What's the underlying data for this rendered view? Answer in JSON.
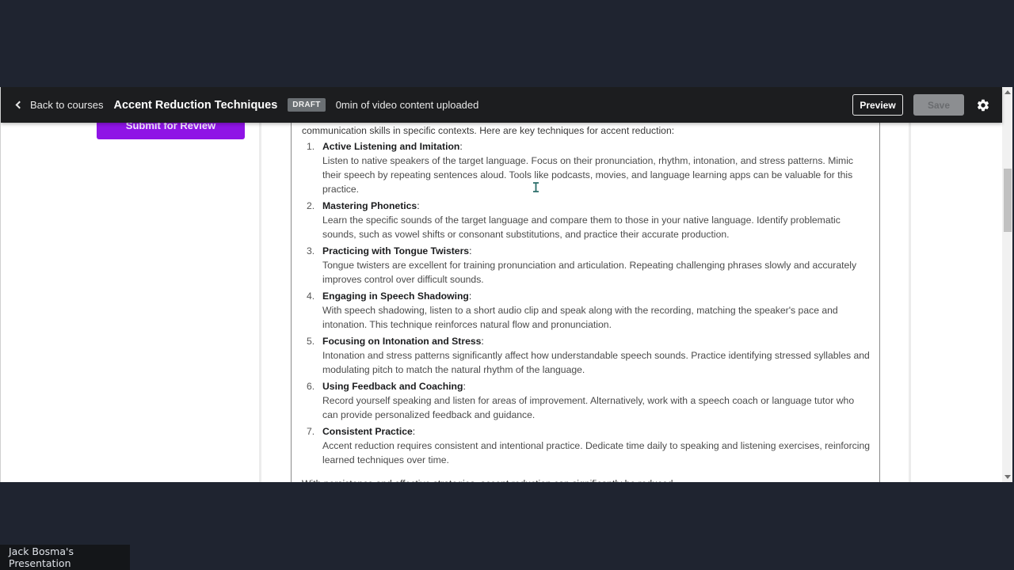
{
  "topbar": {
    "back_label": "Back to courses",
    "course_title": "Accent Reduction Techniques",
    "status_badge": "DRAFT",
    "upload_status": "0min of video content uploaded",
    "preview_label": "Preview",
    "save_label": "Save",
    "settings_icon": "gear-icon"
  },
  "sidebar": {
    "submit_label": "Submit for Review"
  },
  "editor": {
    "intro": "communication skills in specific contexts. Here are key techniques for accent reduction:",
    "techniques": [
      {
        "number": "1.",
        "title": "Active Listening and Imitation",
        "description": "Listen to native speakers of the target language. Focus on their pronunciation, rhythm, intonation, and stress patterns. Mimic their speech by repeating sentences aloud. Tools like podcasts, movies, and language learning apps can be valuable for this practice."
      },
      {
        "number": "2.",
        "title": "Mastering Phonetics",
        "description": "Learn the specific sounds of the target language and compare them to those in your native language. Identify problematic sounds, such as vowel shifts or consonant substitutions, and practice their accurate production."
      },
      {
        "number": "3.",
        "title": "Practicing with Tongue Twisters",
        "description": "Tongue twisters are excellent for training pronunciation and articulation. Repeating challenging phrases slowly and accurately improves control over difficult sounds."
      },
      {
        "number": "4.",
        "title": "Engaging in Speech Shadowing",
        "description": "With speech shadowing, listen to a short audio clip and speak along with the recording, matching the speaker's pace and intonation. This technique reinforces natural flow and pronunciation."
      },
      {
        "number": "5.",
        "title": "Focusing on Intonation and Stress",
        "description": "Intonation and stress patterns significantly affect how understandable speech sounds. Practice identifying stressed syllables and modulating pitch to match the natural rhythm of the language."
      },
      {
        "number": "6.",
        "title": "Using Feedback and Coaching",
        "description": "Record yourself speaking and listen for areas of improvement. Alternatively, work with a speech coach or language tutor who can provide personalized feedback and guidance."
      },
      {
        "number": "7.",
        "title": "Consistent Practice",
        "description": "Accent reduction requires consistent and intentional practice. Dedicate time daily to speaking and listening exercises, reinforcing learned techniques over time."
      }
    ],
    "closing": "With persistence and effective strategies, accent reduction can significantly be reduced."
  },
  "presenter": {
    "label": "Jack Bosma's Presentation"
  },
  "colors": {
    "accent_purple": "#8f14e6",
    "topbar_bg": "#1c1d1f",
    "outer_bg": "#1f2430"
  }
}
